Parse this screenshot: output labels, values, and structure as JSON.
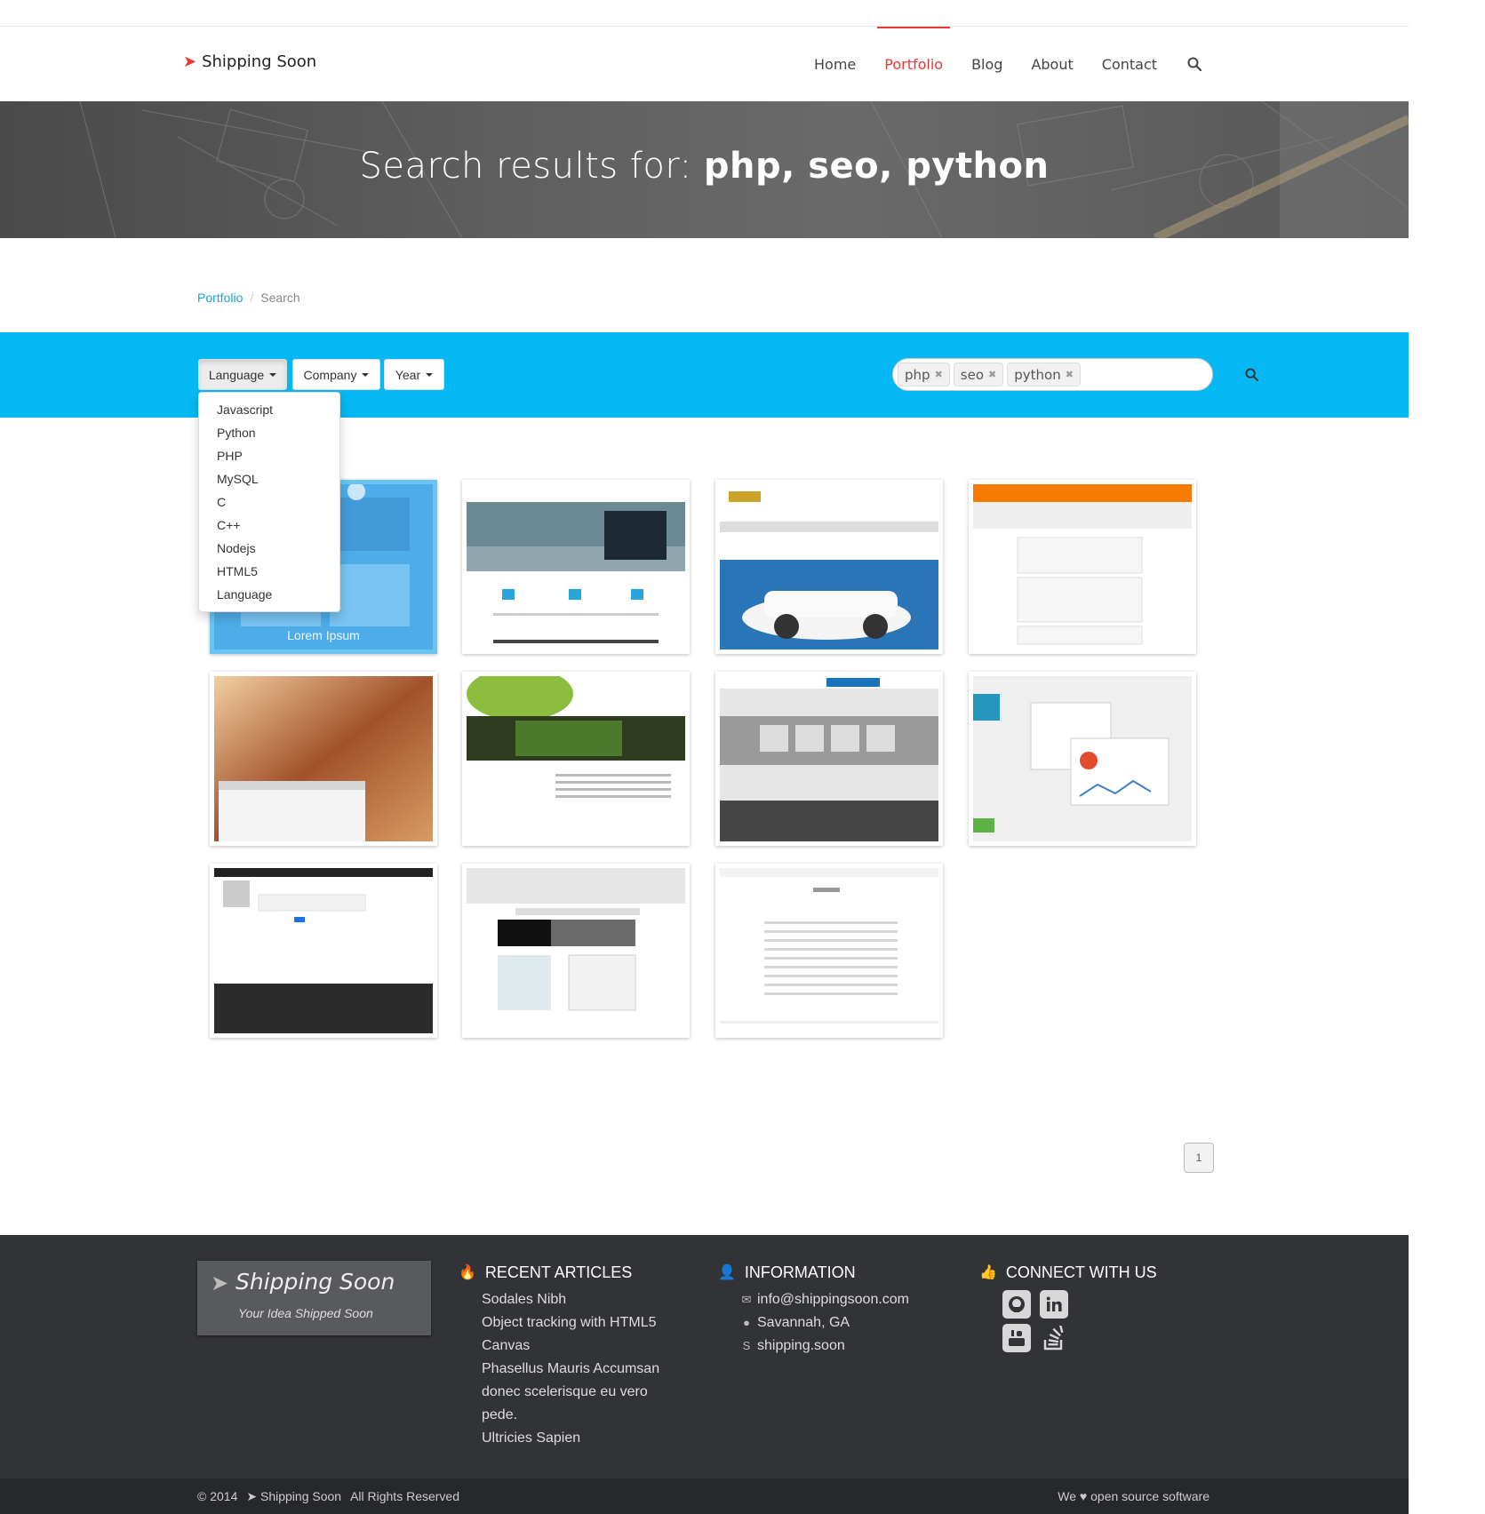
{
  "header": {
    "logo_text": "Shipping Soon",
    "nav": [
      {
        "label": "Home",
        "active": false
      },
      {
        "label": "Portfolio",
        "active": true
      },
      {
        "label": "Blog",
        "active": false
      },
      {
        "label": "About",
        "active": false
      },
      {
        "label": "Contact",
        "active": false
      }
    ]
  },
  "hero": {
    "prefix": "Search results for: ",
    "query": "php, seo, python"
  },
  "breadcrumb": {
    "link": "Portfolio",
    "separator": "/",
    "current": "Search"
  },
  "filters": {
    "language": "Language",
    "company": "Company",
    "year": "Year"
  },
  "search": {
    "tags": [
      "php",
      "seo",
      "python"
    ],
    "remove_glyph": "✖",
    "input_value": ""
  },
  "language_menu": [
    "Javascript",
    "Python",
    "PHP",
    "MySQL",
    "C",
    "C++",
    "Nodejs",
    "HTML5",
    "Language"
  ],
  "portfolio": {
    "hover_caption": "Lorem Ipsum",
    "items": [
      {
        "name": "thumb-blue-site"
      },
      {
        "name": "thumb-shipping-soon"
      },
      {
        "name": "thumb-camaro"
      },
      {
        "name": "thumb-favorbits"
      },
      {
        "name": "thumb-photo-skype"
      },
      {
        "name": "thumb-green-leaves"
      },
      {
        "name": "thumb-used-cars"
      },
      {
        "name": "thumb-analytics"
      },
      {
        "name": "thumb-dashboard"
      },
      {
        "name": "thumb-alpha-phi"
      },
      {
        "name": "thumb-products"
      }
    ]
  },
  "pagination": {
    "current": "1"
  },
  "footer": {
    "brand_name": "Shipping Soon",
    "brand_tagline": "Your Idea Shipped Soon",
    "recent_title": "RECENT ARTICLES",
    "recent_articles": [
      "Sodales Nibh",
      "Object tracking with HTML5",
      "Canvas",
      "Phasellus Mauris Accumsan",
      "donec scelerisque eu vero",
      "pede.",
      "Ultricies Sapien"
    ],
    "info_title": "INFORMATION",
    "email": "info@shippingsoon.com",
    "location": "Savannah, GA",
    "skype": "shipping.soon",
    "connect_title": "CONNECT WITH US",
    "social": [
      "github",
      "linkedin",
      "youtube",
      "stackoverflow"
    ],
    "copyright": "© 2014",
    "bottom_brand": "Shipping Soon",
    "rights": "All Rights Reserved",
    "love": "We ♥ open source software"
  },
  "colors": {
    "accent": "#e53935",
    "filter_bar": "#05b8f3",
    "footer_bg": "#323337",
    "link": "#1aa3d9"
  }
}
